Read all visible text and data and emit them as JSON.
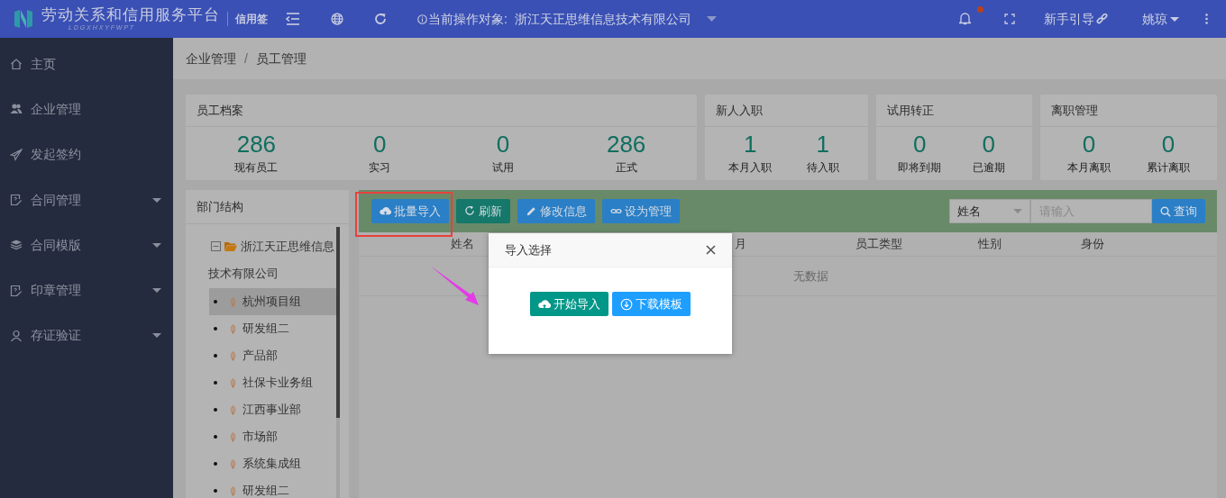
{
  "header": {
    "title": "劳动关系和信用服务平台",
    "subtitle": "L D G X H X Y F W P T",
    "tag": "信用签",
    "target_label": "当前操作对象:",
    "target_value": "浙江天正思维信息技术有限公司",
    "notification_unread": true,
    "guide_link": "新手引导",
    "user": "姚琼"
  },
  "sidebar": {
    "items": [
      {
        "label": "主页",
        "kind": "link"
      },
      {
        "label": "企业管理",
        "kind": "link"
      },
      {
        "label": "发起签约",
        "kind": "link"
      },
      {
        "label": "合同管理",
        "kind": "group"
      },
      {
        "label": "合同模版",
        "kind": "group"
      },
      {
        "label": "印章管理",
        "kind": "group"
      },
      {
        "label": "存证验证",
        "kind": "group"
      }
    ]
  },
  "breadcrumb": [
    "企业管理",
    "/",
    "员工管理"
  ],
  "stat_cards": [
    {
      "title": "员工档案",
      "stats": [
        {
          "value": "286",
          "label": "现有员工"
        },
        {
          "value": "0",
          "label": "实习"
        },
        {
          "value": "0",
          "label": "试用"
        },
        {
          "value": "286",
          "label": "正式"
        }
      ]
    },
    {
      "title": "新人入职",
      "stats": [
        {
          "value": "1",
          "label": "本月入职"
        },
        {
          "value": "1",
          "label": "待入职"
        }
      ]
    },
    {
      "title": "试用转正",
      "stats": [
        {
          "value": "0",
          "label": "即将到期"
        },
        {
          "value": "0",
          "label": "已逾期"
        }
      ]
    },
    {
      "title": "离职管理",
      "stats": [
        {
          "value": "0",
          "label": "本月离职"
        },
        {
          "value": "0",
          "label": "累计离职"
        }
      ]
    }
  ],
  "department_tree": {
    "title": "部门结构",
    "root": {
      "label": "浙江天正思维信息技术有限公司",
      "expanded": true,
      "children": [
        {
          "label": "杭州项目组",
          "selected": true
        },
        {
          "label": "研发组二",
          "selected": false
        },
        {
          "label": "产品部",
          "selected": false
        },
        {
          "label": "社保卡业务组",
          "selected": false
        },
        {
          "label": "江西事业部",
          "selected": false
        },
        {
          "label": "市场部",
          "selected": false
        },
        {
          "label": "系统集成组",
          "selected": false
        },
        {
          "label": "研发组二",
          "selected": false
        }
      ]
    }
  },
  "toolbar": {
    "buttons": [
      {
        "label": "批量导入",
        "kind": "import"
      },
      {
        "label": "刷新",
        "kind": "refresh"
      },
      {
        "label": "修改信息",
        "kind": "edit"
      },
      {
        "label": "设为管理",
        "kind": "link"
      }
    ],
    "search_field": {
      "value": "姓名"
    },
    "search_input": {
      "placeholder": "请输入"
    },
    "search_button": "查询"
  },
  "table": {
    "columns": [
      "姓名",
      "月",
      "员工类型",
      "性别",
      "身份"
    ],
    "empty_text": "无数据"
  },
  "dialog": {
    "title": "导入选择",
    "buttons": [
      {
        "label": "开始导入",
        "kind": "upload"
      },
      {
        "label": "下载模板",
        "kind": "download"
      }
    ]
  }
}
